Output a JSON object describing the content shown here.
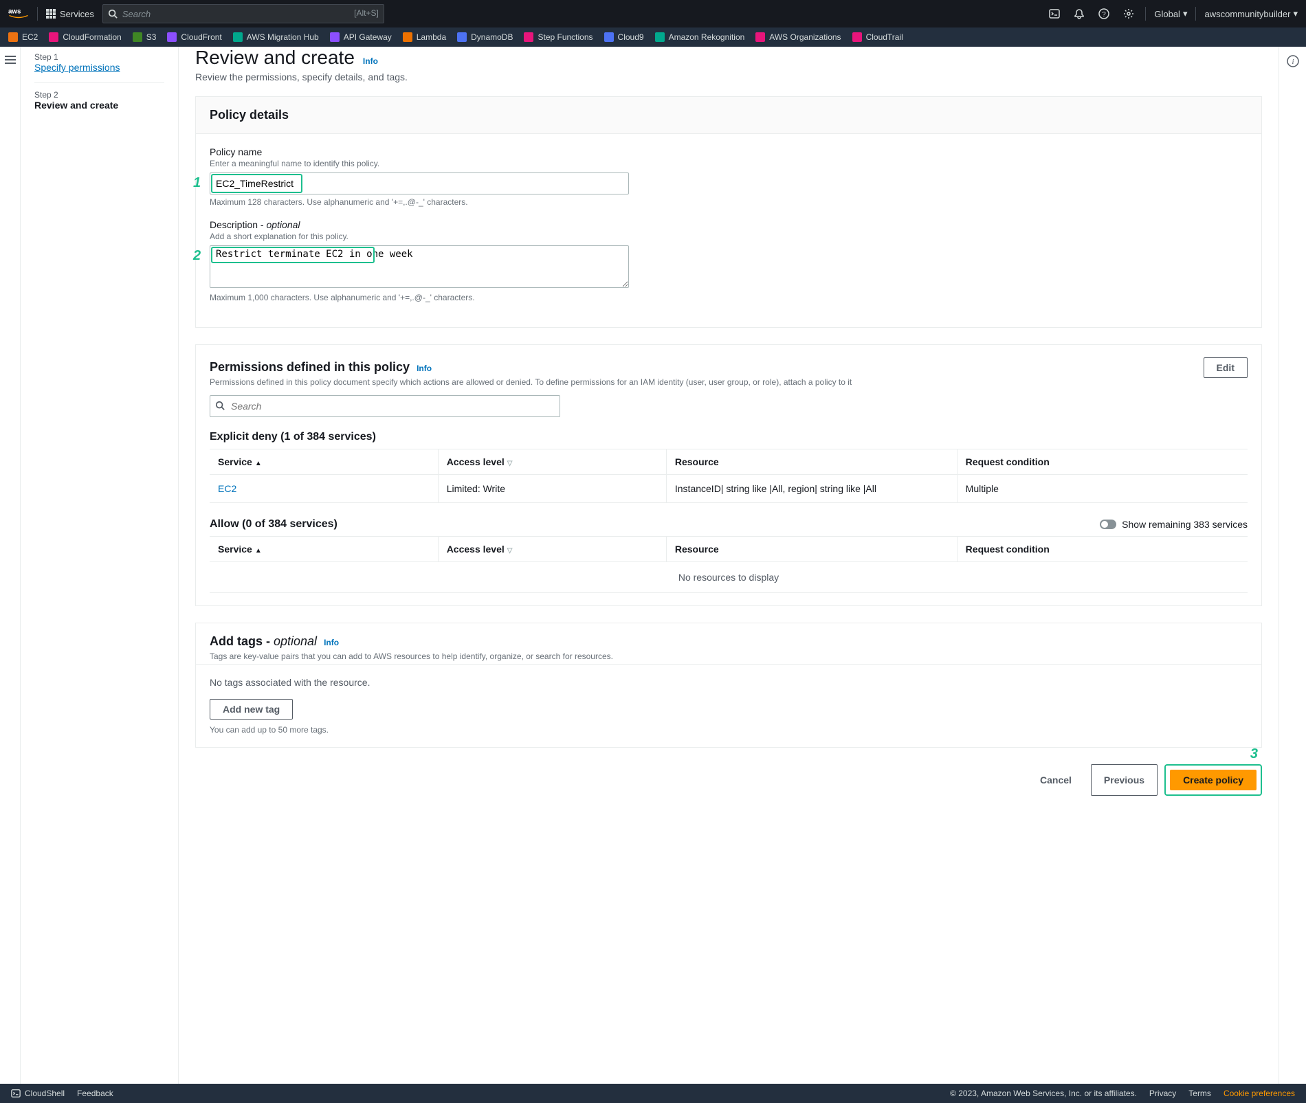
{
  "nav": {
    "services_label": "Services",
    "search_placeholder": "Search",
    "search_shortcut": "[Alt+S]",
    "region": "Global",
    "user": "awscommunitybuilder"
  },
  "favorites": [
    {
      "label": "EC2",
      "color": "#ec7211"
    },
    {
      "label": "CloudFormation",
      "color": "#e7157b"
    },
    {
      "label": "S3",
      "color": "#3f8624"
    },
    {
      "label": "CloudFront",
      "color": "#8c4fff"
    },
    {
      "label": "AWS Migration Hub",
      "color": "#01a88d"
    },
    {
      "label": "API Gateway",
      "color": "#8c4fff"
    },
    {
      "label": "Lambda",
      "color": "#ed7100"
    },
    {
      "label": "DynamoDB",
      "color": "#4d72f3"
    },
    {
      "label": "Step Functions",
      "color": "#e7157b"
    },
    {
      "label": "Cloud9",
      "color": "#4d72f3"
    },
    {
      "label": "Amazon Rekognition",
      "color": "#01a88d"
    },
    {
      "label": "AWS Organizations",
      "color": "#e7157b"
    },
    {
      "label": "CloudTrail",
      "color": "#e7157b"
    }
  ],
  "wizard": {
    "step1_label": "Step 1",
    "step1_title": "Specify permissions",
    "step2_label": "Step 2",
    "step2_title": "Review and create"
  },
  "page": {
    "title": "Review and create",
    "info": "Info",
    "desc": "Review the permissions, specify details, and tags."
  },
  "details": {
    "heading": "Policy details",
    "name_label": "Policy name",
    "name_hint": "Enter a meaningful name to identify this policy.",
    "name_value": "EC2_TimeRestrict",
    "name_constraint": "Maximum 128 characters. Use alphanumeric and '+=,.@-_' characters.",
    "desc_label": "Description - ",
    "desc_optional": "optional",
    "desc_hint": "Add a short explanation for this policy.",
    "desc_value": "Restrict terminate EC2 in one week",
    "desc_constraint": "Maximum 1,000 characters. Use alphanumeric and '+=,.@-_' characters."
  },
  "permissions": {
    "heading": "Permissions defined in this policy",
    "desc": "Permissions defined in this policy document specify which actions are allowed or denied. To define permissions for an IAM identity (user, user group, or role), attach a policy to it",
    "edit": "Edit",
    "search_placeholder": "Search",
    "deny_title": "Explicit deny (1 of 384 services)",
    "cols": {
      "service": "Service",
      "access": "Access level",
      "resource": "Resource",
      "condition": "Request condition"
    },
    "deny_rows": [
      {
        "service": "EC2",
        "access": "Limited: Write",
        "resource": "InstanceID| string like |All, region| string like |All",
        "condition": "Multiple"
      }
    ],
    "allow_title": "Allow (0 of 384 services)",
    "toggle_label": "Show remaining 383 services",
    "no_resources": "No resources to display"
  },
  "tags": {
    "heading": "Add tags - ",
    "optional": "optional",
    "desc": "Tags are key-value pairs that you can add to AWS resources to help identify, organize, or search for resources.",
    "empty": "No tags associated with the resource.",
    "add_btn": "Add new tag",
    "limit": "You can add up to 50 more tags."
  },
  "actions": {
    "cancel": "Cancel",
    "previous": "Previous",
    "create": "Create policy"
  },
  "footer": {
    "cloudshell": "CloudShell",
    "feedback": "Feedback",
    "copyright": "© 2023, Amazon Web Services, Inc. or its affiliates.",
    "privacy": "Privacy",
    "terms": "Terms",
    "cookies": "Cookie preferences"
  },
  "callouts": {
    "one": "1",
    "two": "2",
    "three": "3"
  }
}
